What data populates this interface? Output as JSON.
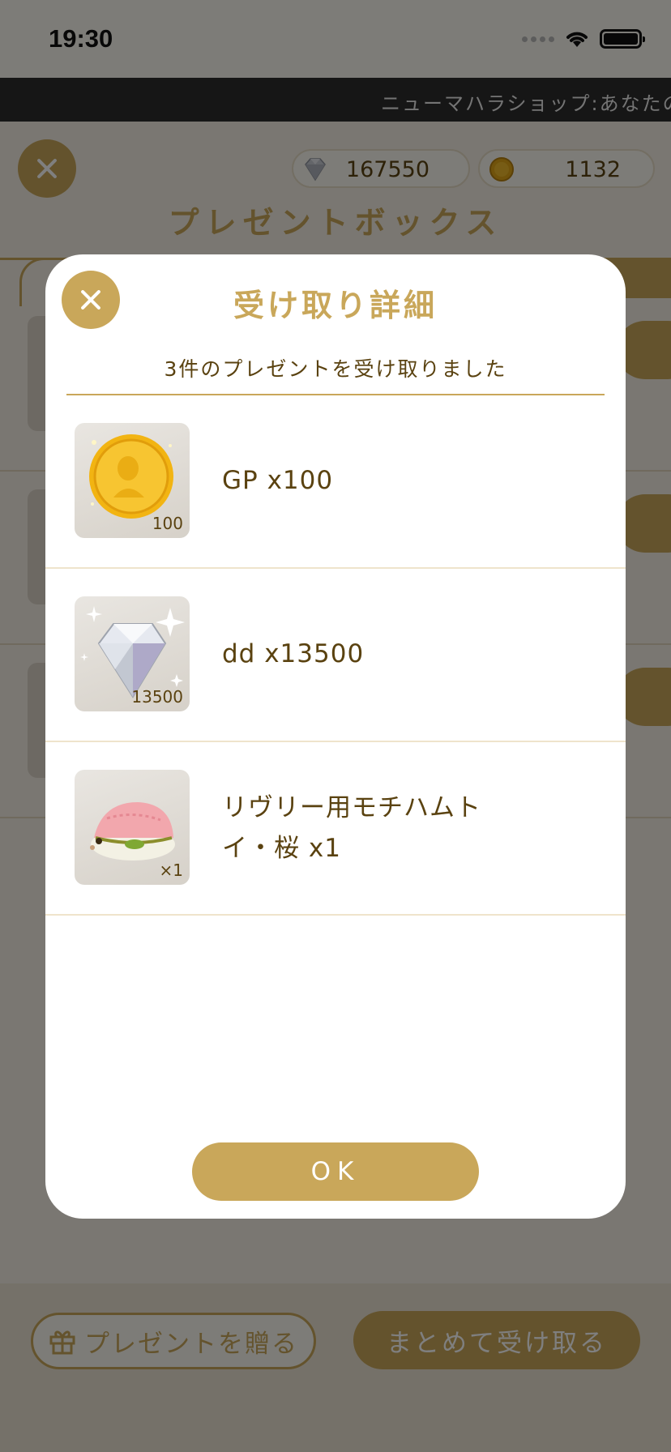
{
  "status_bar": {
    "time": "19:30"
  },
  "ticker": {
    "text": "ニューマハラショップ:あなたの"
  },
  "header": {
    "gems": "167550",
    "coins": "1132",
    "title": "プレゼントボックス"
  },
  "footer": {
    "give_label": "プレゼントを贈る",
    "receive_all_label": "まとめて受け取る"
  },
  "modal": {
    "title": "受け取り詳細",
    "subtitle": "3件のプレゼントを受け取りました",
    "items": [
      {
        "name": "GP x100",
        "qty": "100",
        "icon": "gold-coin-icon"
      },
      {
        "name": "dd x13500",
        "qty": "13500",
        "icon": "diamond-icon"
      },
      {
        "name_line1": "リヴリー用モチハムト",
        "name_line2": "イ・桜 x1",
        "qty": "×1",
        "icon": "hamster-icon"
      }
    ],
    "ok_label": "OK"
  },
  "colors": {
    "accent": "#c9a75a",
    "text_brown": "#5a4210",
    "overlay": "rgba(0,0,0,0.5)"
  }
}
